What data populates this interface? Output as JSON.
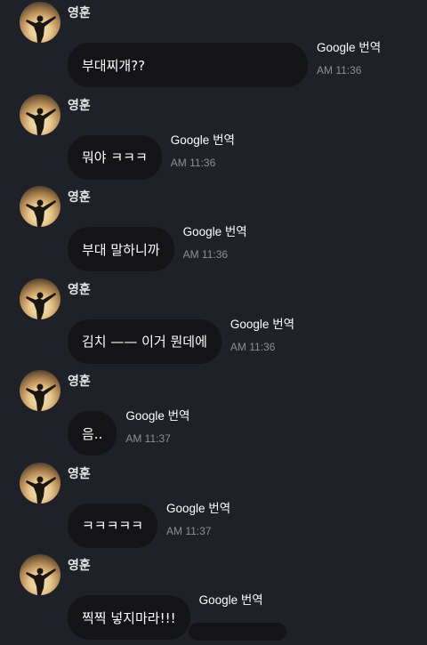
{
  "messages": [
    {
      "sender": "영훈",
      "text": "부대찌개??",
      "translate": "Google 번역",
      "time": "AM 11:36"
    },
    {
      "sender": "영훈",
      "text": "뭐야 ㅋㅋㅋ",
      "translate": "Google 번역",
      "time": "AM 11:36"
    },
    {
      "sender": "영훈",
      "text": "부대 말하니까",
      "translate": "Google 번역",
      "time": "AM 11:36"
    },
    {
      "sender": "영훈",
      "text": "김치 —— 이거 뭔데에",
      "translate": "Google 번역",
      "time": "AM 11:36"
    },
    {
      "sender": "영훈",
      "text": "음..",
      "translate": "Google 번역",
      "time": "AM 11:37"
    },
    {
      "sender": "영훈",
      "text": "ㅋㅋㅋㅋㅋ",
      "translate": "Google 번역",
      "time": "AM 11:37"
    },
    {
      "sender": "영훈",
      "text": "찍찍 넣지마라!!!",
      "translate": "Google 번역",
      "time": ""
    }
  ],
  "colors": {
    "background": "#1f2128",
    "bubble": "#141416",
    "time": "#8c8f97"
  }
}
